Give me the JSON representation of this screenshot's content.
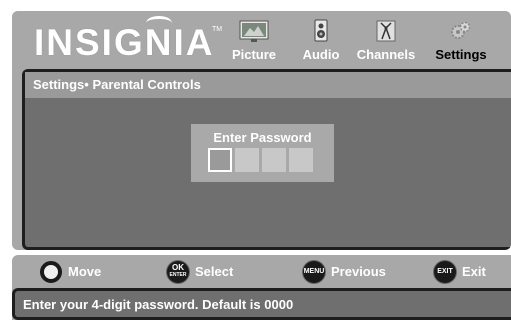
{
  "brand": {
    "logo_text": "INSIGNIA",
    "trademark": "TM"
  },
  "tabs": [
    {
      "label": "Picture",
      "icon": "picture-icon",
      "active": false
    },
    {
      "label": "Audio",
      "icon": "speaker-icon",
      "active": false
    },
    {
      "label": "Channels",
      "icon": "antenna-icon",
      "active": false
    },
    {
      "label": "Settings",
      "icon": "gears-icon",
      "active": true
    }
  ],
  "breadcrumb": "Settings• Parental Controls",
  "password_dialog": {
    "title": "Enter Password",
    "digit_count": 4,
    "active_digit": 1
  },
  "hints": [
    {
      "icon": "dpad-icon",
      "icon_text": "",
      "label": "Move"
    },
    {
      "icon": "ok-enter-button-icon",
      "icon_text": "OK",
      "icon_subtext": "ENTER",
      "label": "Select"
    },
    {
      "icon": "menu-button-icon",
      "icon_text": "MENU",
      "label": "Previous"
    },
    {
      "icon": "exit-button-icon",
      "icon_text": "EXIT",
      "label": "Exit"
    }
  ],
  "status_message": "Enter your 4-digit password. Default is 0000",
  "colors": {
    "frame_gray": "#a8a8a8",
    "panel_dark": "#6f6f6f",
    "border": "#1e1e1e",
    "text": "#ffffff",
    "active_tab_text": "#000000"
  }
}
